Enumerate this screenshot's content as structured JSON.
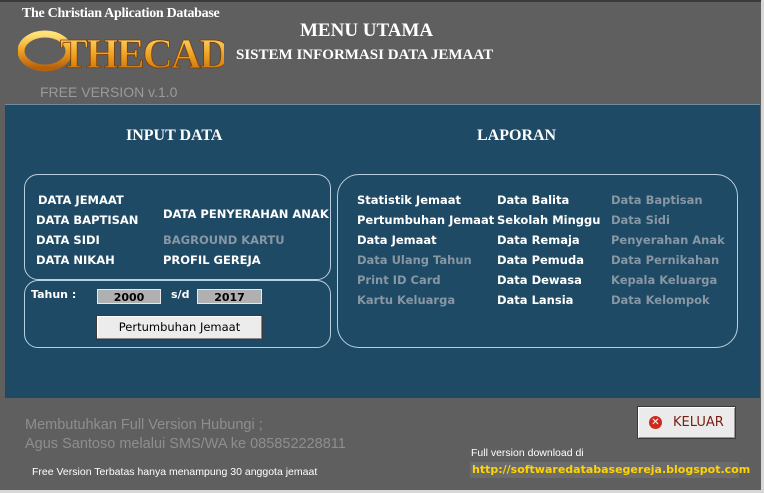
{
  "header": {
    "logo_tagline": "The Christian Aplication Database",
    "logo_text": "THECAD",
    "logo_version": "FREE VERSION v.1.0",
    "title": "MENU UTAMA",
    "subtitle": "SISTEM INFORMASI DATA JEMAAT"
  },
  "input_data": {
    "title": "INPUT DATA",
    "items": [
      {
        "label": "DATA JEMAAT",
        "enabled": true
      },
      {
        "label": "DATA BAPTISAN",
        "enabled": true
      },
      {
        "label": "DATA SIDI",
        "enabled": true
      },
      {
        "label": "DATA NIKAH",
        "enabled": true
      },
      {
        "label": "DATA PENYERAHAN ANAK",
        "enabled": true
      },
      {
        "label": "BAGROUND KARTU",
        "enabled": false
      },
      {
        "label": "PROFIL GEREJA",
        "enabled": true
      }
    ],
    "year_label": "Tahun :",
    "year_from": "2000",
    "year_sep": "s/d",
    "year_to": "2017",
    "growth_button": "Pertumbuhan Jemaat"
  },
  "laporan": {
    "title": "LAPORAN",
    "col1": [
      {
        "label": "Statistik Jemaat",
        "enabled": true
      },
      {
        "label": "Pertumbuhan Jemaat",
        "enabled": true
      },
      {
        "label": "Data Jemaat",
        "enabled": true
      },
      {
        "label": "Data Ulang Tahun",
        "enabled": false
      },
      {
        "label": "Print ID Card",
        "enabled": false
      },
      {
        "label": "Kartu Keluarga",
        "enabled": false
      }
    ],
    "col2": [
      {
        "label": "Data Balita",
        "enabled": true
      },
      {
        "label": "Sekolah Minggu",
        "enabled": true
      },
      {
        "label": "Data Remaja",
        "enabled": true
      },
      {
        "label": "Data Pemuda",
        "enabled": true
      },
      {
        "label": "Data Dewasa",
        "enabled": true
      },
      {
        "label": "Data Lansia",
        "enabled": true
      }
    ],
    "col3": [
      {
        "label": "Data Baptisan",
        "enabled": false
      },
      {
        "label": "Data Sidi",
        "enabled": false
      },
      {
        "label": "Penyerahan Anak",
        "enabled": false
      },
      {
        "label": "Data Pernikahan",
        "enabled": false
      },
      {
        "label": "Kepala Keluarga",
        "enabled": false
      },
      {
        "label": "Data Kelompok",
        "enabled": false
      }
    ]
  },
  "footer": {
    "contact_line1": "Membutuhkan Full Version Hubungi ;",
    "contact_line2": "Agus  Santoso melalui SMS/WA ke  085852228811",
    "limit_note": "Free Version Terbatas hanya menampung 30 anggota jemaat",
    "download_label": "Full version download di",
    "download_url": "http://softwaredatabasegereja.blogspot.com",
    "exit_button": "KELUAR",
    "exit_icon": "close-circle-icon"
  },
  "colors": {
    "background": "#5f5f5f",
    "panel": "#1f4a65",
    "enabled_text": "#ffffff",
    "disabled_text": "#8797a4",
    "url_text": "#ffd400",
    "exit_icon": "#d02a1e"
  }
}
